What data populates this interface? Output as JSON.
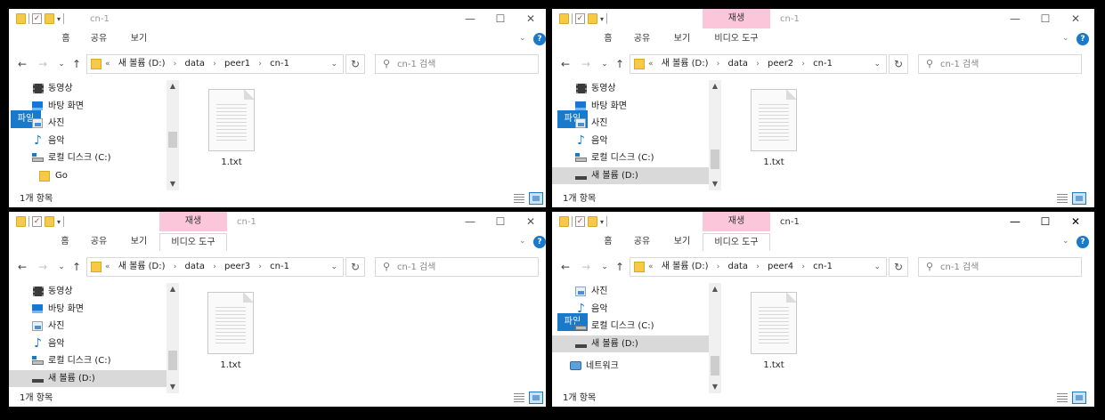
{
  "quick_access": {
    "dropdown": "▾",
    "check": "✓"
  },
  "controls": {
    "minimize": "—",
    "maximize": "☐",
    "close": "✕"
  },
  "ribbon": {
    "file": "파일",
    "home": "홈",
    "share": "공유",
    "view": "보기",
    "video_tools": "비디오 도구",
    "play_tab": "재생",
    "help": "?",
    "chevron": "⌄"
  },
  "nav": {
    "back": "←",
    "forward": "→",
    "recent": "⌄",
    "up": "↑",
    "refresh": "↻",
    "search_icon": "⚲"
  },
  "windows": [
    {
      "title": "cn-1",
      "breadcrumb": [
        "«",
        "새 볼륨 (D:)",
        "›",
        "data",
        "›",
        "peer1",
        "›",
        "cn-1"
      ],
      "search_placeholder": "cn-1 검색",
      "tree": [
        "동영상",
        "바탕 화면",
        "사진",
        "음악",
        "로컬 디스크 (C:)",
        "Go"
      ],
      "file_name": "1.txt",
      "status": "1개 항목"
    },
    {
      "title": "cn-1",
      "breadcrumb": [
        "«",
        "새 볼륨 (D:)",
        "›",
        "data",
        "›",
        "peer2",
        "›",
        "cn-1"
      ],
      "search_placeholder": "cn-1 검색",
      "tree": [
        "동영상",
        "바탕 화면",
        "사진",
        "음악",
        "로컬 디스크 (C:)",
        "새 볼륨 (D:)"
      ],
      "file_name": "1.txt",
      "status": "1개 항목"
    },
    {
      "title": "cn-1",
      "breadcrumb": [
        "«",
        "새 볼륨 (D:)",
        "›",
        "data",
        "›",
        "peer3",
        "›",
        "cn-1"
      ],
      "search_placeholder": "cn-1 검색",
      "tree": [
        "동영상",
        "바탕 화면",
        "사진",
        "음악",
        "로컬 디스크 (C:)",
        "새 볼륨 (D:)"
      ],
      "file_name": "1.txt",
      "status": "1개 항목"
    },
    {
      "title": "cn-1",
      "breadcrumb": [
        "«",
        "새 볼륨 (D:)",
        "›",
        "data",
        "›",
        "peer4",
        "›",
        "cn-1"
      ],
      "search_placeholder": "cn-1 검색",
      "tree": [
        "사진",
        "음악",
        "로컬 디스크 (C:)",
        "새 볼륨 (D:)",
        "네트워크"
      ],
      "file_name": "1.txt",
      "status": "1개 항목"
    }
  ]
}
